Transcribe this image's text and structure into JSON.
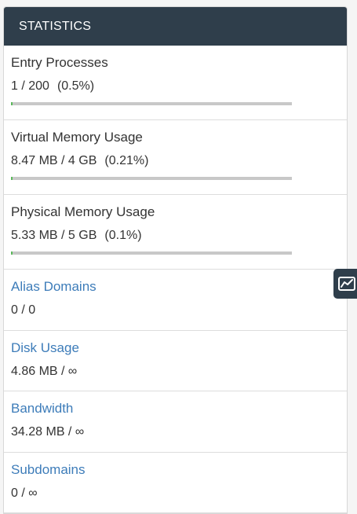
{
  "header": {
    "title": "STATISTICS"
  },
  "stats": [
    {
      "label": "Entry Processes",
      "value": "1 / 200",
      "percent_text": "(0.5%)",
      "percent": 0.5
    },
    {
      "label": "Virtual Memory Usage",
      "value": "8.47 MB / 4 GB",
      "percent_text": "(0.21%)",
      "percent": 0.21
    },
    {
      "label": "Physical Memory Usage",
      "value": "5.33 MB / 5 GB",
      "percent_text": "(0.1%)",
      "percent": 0.1
    },
    {
      "label": "Alias Domains",
      "value": "0 / 0"
    },
    {
      "label": "Disk Usage",
      "value": "4.86 MB / ∞"
    },
    {
      "label": "Bandwidth",
      "value": "34.28 MB / ∞"
    },
    {
      "label": "Subdomains",
      "value": "0 / ∞"
    }
  ],
  "side_tab": {
    "icon": "chart-trend-icon"
  },
  "colors": {
    "header_bg": "#2f3e4b",
    "link": "#3d7cb9",
    "progress_fill": "#5cb85c",
    "progress_track": "#c8c8c8"
  }
}
